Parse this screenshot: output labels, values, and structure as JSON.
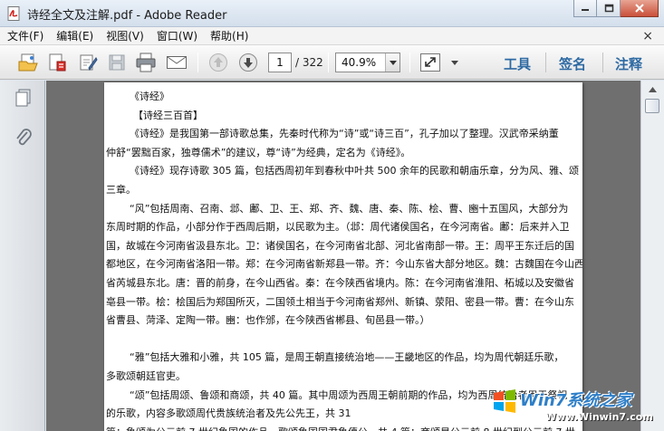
{
  "window": {
    "title": "诗经全文及注解.pdf - Adobe Reader"
  },
  "menu": {
    "items": [
      "文件(F)",
      "编辑(E)",
      "视图(V)",
      "窗口(W)",
      "帮助(H)"
    ],
    "close_glyph": "×"
  },
  "toolbar": {
    "page_current": "1",
    "page_total": "/ 322",
    "zoom": "40.9%",
    "tools_label": "工具",
    "sign_label": "签名",
    "comment_label": "注释"
  },
  "document": {
    "lines": [
      "《诗经》",
      "【诗经三百首】",
      "《诗经》是我国第一部诗歌总集，先秦时代称为“诗”或“诗三百”，孔子加以了整理。汉武帝采纳董",
      "仲舒“罢黜百家，独尊儒术”的建议，尊“诗”为经典，定名为《诗经》。",
      "《诗经》现存诗歌 305 篇，包括西周初年到春秋中叶共 500 余年的民歌和朝庙乐章，分为风、雅、颂",
      "三章。",
      "“风”包括周南、召南、邶、鄘、卫、王、郑、齐、魏、唐、秦、陈、桧、曹、豳十五国风，大部分为",
      "东周时期的作品，小部分作于西周后期，以民歌为主。（邶：周代诸侯国名，在今河南省。鄘：后来并入卫",
      "国，故城在今河南省汲县东北。卫：诸侯国名，在今河南省北部、河北省南部一带。王：周平王东迁后的国",
      "都地区，在今河南省洛阳一带。郑：在今河南省新郑县一带。齐：今山东省大部分地区。魏：古魏国在今山西",
      "省芮城县东北。唐：晋的前身，在今山西省。秦：在今陕西省境内。陈：在今河南省淮阳、柘城以及安徽省",
      "亳县一带。桧：桧国后为郑国所灭，二国领土相当于今河南省郑州、新镇、荥阳、密县一带。曹：在今山东",
      "省曹县、菏泽、定陶一带。豳：也作邠，在今陕西省郴县、旬邑县一带。）",
      "",
      "“雅”包括大雅和小雅，共 105 篇，是周王朝直接统治地——王畿地区的作品，均为周代朝廷乐歌，",
      "多歌颂朝廷官吏。",
      "“颂”包括周颂、鲁颂和商颂，共 40 篇。其中周颂为西周王朝前期的作品，均为西周统治者用于祭祀",
      "的乐歌，内容多歌颂周代贵族统治者及先公先王，共 31",
      "篇；鲁颂为公元前 7 世纪鲁国的作品，歌颂鲁国国君鲁僖公，共 4 篇；商颂是公元前 8 世纪到公元前 7 世"
    ]
  },
  "watermark": {
    "brand": "Win7系统之家",
    "url": "Www.Winwin7.com"
  }
}
